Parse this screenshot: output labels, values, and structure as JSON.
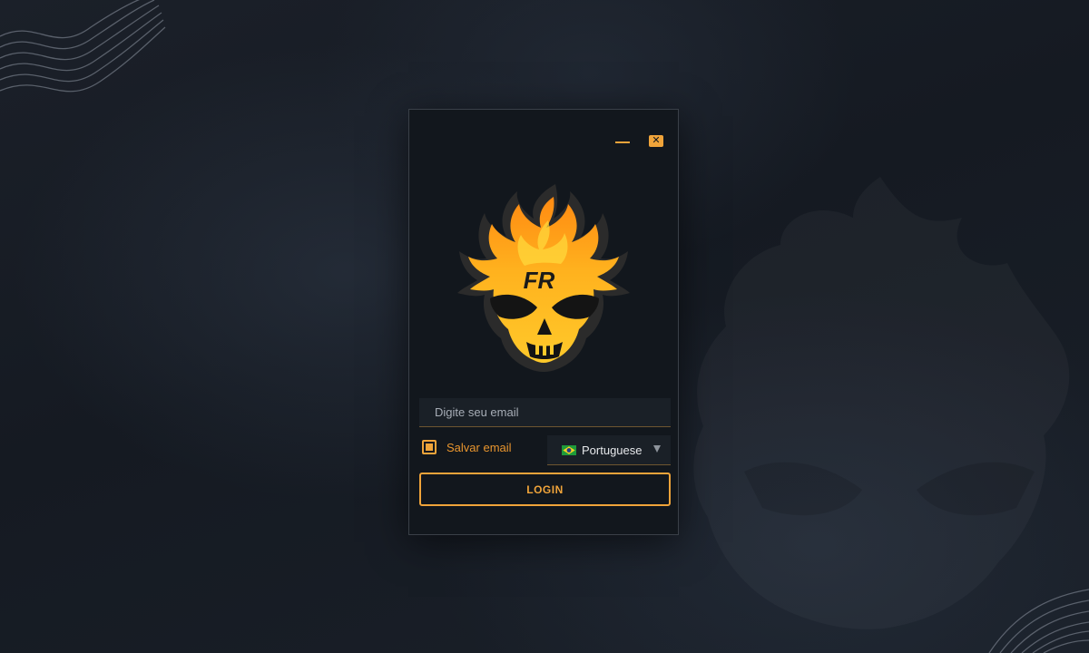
{
  "window": {
    "minimize_icon": "minimize-icon",
    "close_icon": "close-icon",
    "close_glyph": "✕"
  },
  "logo": {
    "icon": "flaming-skull-logo",
    "text": "FR"
  },
  "form": {
    "email_placeholder": "Digite seu email",
    "email_value": "",
    "remember_label": "Salvar email",
    "remember_checked": true,
    "language_selected": "Portuguese",
    "language_flag": "brazil-flag-icon",
    "login_label": "LOGIN"
  },
  "colors": {
    "accent": "#f0a43a",
    "panel": "#12171d",
    "input_bg": "#1a2027",
    "background": "#171c24"
  }
}
